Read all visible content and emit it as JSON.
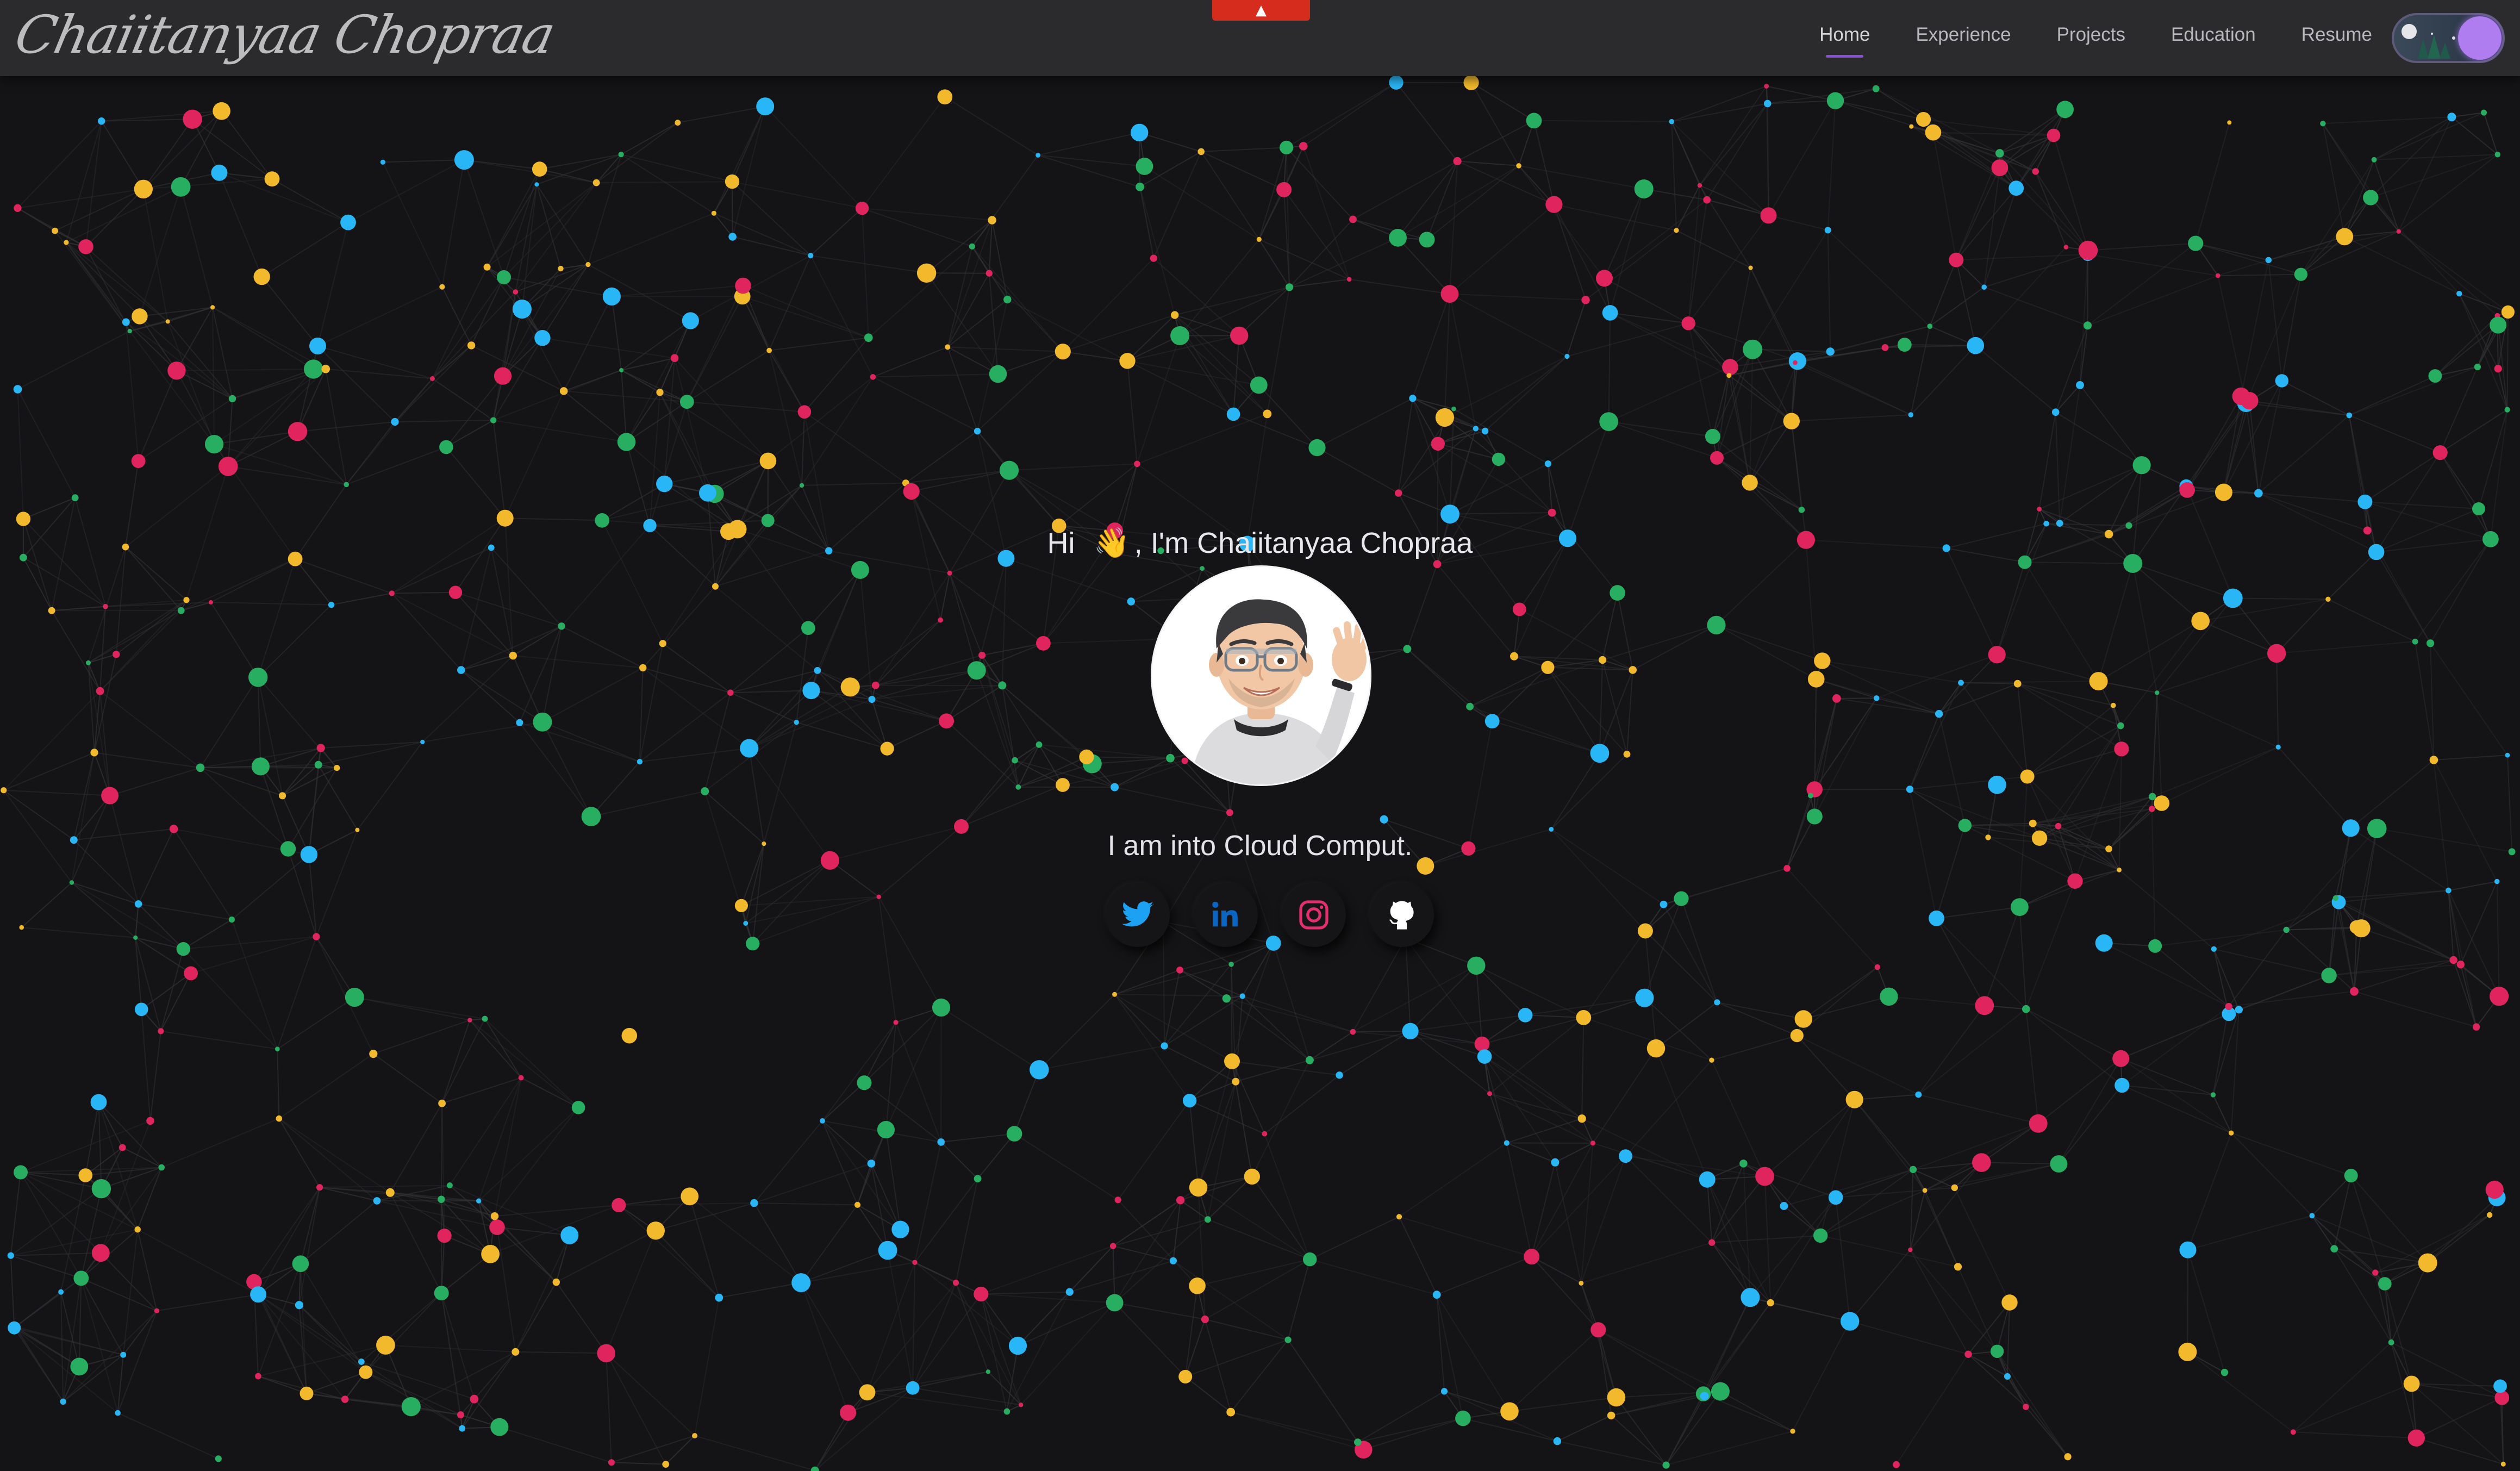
{
  "logo": {
    "text": "Chaiitanyaa Chopraa"
  },
  "nav": {
    "items": [
      {
        "label": "Home",
        "active": true
      },
      {
        "label": "Experience",
        "active": false
      },
      {
        "label": "Projects",
        "active": false
      },
      {
        "label": "Education",
        "active": false
      },
      {
        "label": "Resume",
        "active": false
      }
    ],
    "accent_color": "#8a4fd8"
  },
  "top_tab": {
    "icon": "arrow-up-icon",
    "color": "#d62c1e"
  },
  "theme_toggle": {
    "state": "dark",
    "knob_color": "#b07df0"
  },
  "hero": {
    "greeting_prefix": "Hi",
    "greeting_emoji": "👋",
    "greeting_suffix": ", I'm Chaiitanyaa Chopraa",
    "tagline": "I am into Cloud Comput.",
    "avatar_icon": "memoji-avatar-icon"
  },
  "socials": [
    {
      "name": "twitter",
      "icon": "twitter-icon",
      "color": "#1da1f2"
    },
    {
      "name": "linkedin",
      "icon": "linkedin-icon",
      "color": "#0a66c2"
    },
    {
      "name": "instagram",
      "icon": "instagram-icon",
      "color": "#e1306c"
    },
    {
      "name": "github",
      "icon": "github-icon",
      "color": "#ffffff"
    }
  ],
  "background": {
    "color": "#141416",
    "particle_colors": [
      "#e0245e",
      "#27ae60",
      "#29b6f6",
      "#f1b92b"
    ],
    "line_color": "#4a4a4e"
  }
}
